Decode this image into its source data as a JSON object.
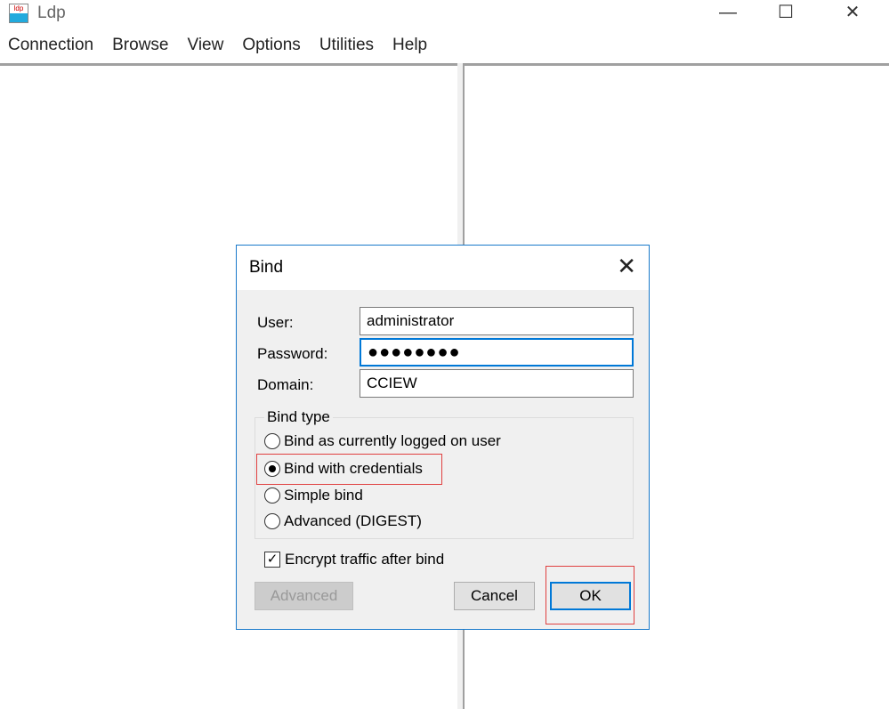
{
  "window": {
    "title": "Ldp",
    "icon": "ldp-app-icon",
    "minimize": "—",
    "maximize": "☐",
    "close": "✕"
  },
  "menu": [
    "Connection",
    "Browse",
    "View",
    "Options",
    "Utilities",
    "Help"
  ],
  "dialog": {
    "title": "Bind",
    "close": "✕",
    "user_label": "User:",
    "user_value": "administrator",
    "password_label": "Password:",
    "password_value": "●●●●●●●●",
    "domain_label": "Domain:",
    "domain_value": "CCIEW",
    "bind_type_label": "Bind type",
    "options": [
      {
        "label": "Bind as currently logged on user",
        "selected": false
      },
      {
        "label": "Bind with credentials",
        "selected": true
      },
      {
        "label": "Simple bind",
        "selected": false
      },
      {
        "label": "Advanced (DIGEST)",
        "selected": false
      }
    ],
    "encrypt_label": "Encrypt traffic after bind",
    "encrypt_checked": true,
    "advanced_button": "Advanced",
    "cancel_button": "Cancel",
    "ok_button": "OK"
  },
  "highlight_color": "#e04040",
  "accent": "#0078d7"
}
